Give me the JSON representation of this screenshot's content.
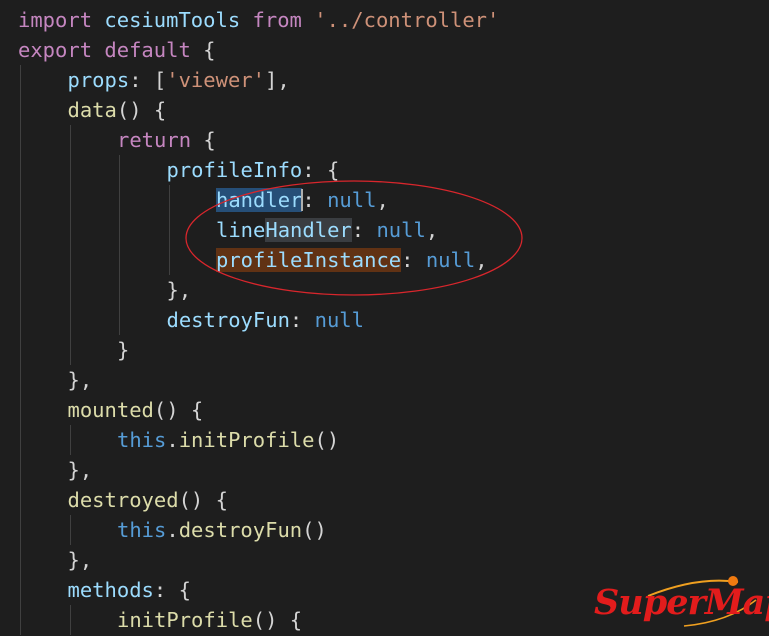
{
  "editor": {
    "theme": {
      "background": "#1e1e1e",
      "keyword": "#c586c0",
      "storage": "#569cd6",
      "variable": "#9cdcfe",
      "function": "#dcdcaa",
      "string": "#ce9178",
      "punctuation": "#d4d4d4",
      "selection": "#264f78",
      "word_highlight": "#3a3d41",
      "find_match": "#613214"
    },
    "lines": [
      {
        "indent": 0,
        "tokens": [
          {
            "t": "kw",
            "v": "import"
          },
          {
            "t": "p",
            "v": " "
          },
          {
            "t": "id",
            "v": "cesiumTools"
          },
          {
            "t": "p",
            "v": " "
          },
          {
            "t": "kw",
            "v": "from"
          },
          {
            "t": "p",
            "v": " "
          },
          {
            "t": "str",
            "v": "'../controller'"
          }
        ]
      },
      {
        "indent": 0,
        "tokens": [
          {
            "t": "kw",
            "v": "export"
          },
          {
            "t": "p",
            "v": " "
          },
          {
            "t": "kw",
            "v": "default"
          },
          {
            "t": "p",
            "v": " {"
          }
        ]
      },
      {
        "indent": 1,
        "tokens": [
          {
            "t": "id",
            "v": "props"
          },
          {
            "t": "p",
            "v": ": ["
          },
          {
            "t": "str",
            "v": "'viewer'"
          },
          {
            "t": "p",
            "v": "],"
          }
        ]
      },
      {
        "indent": 1,
        "tokens": [
          {
            "t": "fn",
            "v": "data"
          },
          {
            "t": "p",
            "v": "() {"
          }
        ]
      },
      {
        "indent": 2,
        "tokens": [
          {
            "t": "kw",
            "v": "return"
          },
          {
            "t": "p",
            "v": " {"
          }
        ]
      },
      {
        "indent": 3,
        "tokens": [
          {
            "t": "id",
            "v": "profileInfo"
          },
          {
            "t": "p",
            "v": ": {"
          }
        ]
      },
      {
        "indent": 4,
        "tokens": [
          {
            "t": "id",
            "v": "handler",
            "hl": "sel",
            "cursor": true
          },
          {
            "t": "p",
            "v": ": "
          },
          {
            "t": "kw2",
            "v": "null"
          },
          {
            "t": "p",
            "v": ","
          }
        ]
      },
      {
        "indent": 4,
        "tokens": [
          {
            "t": "id",
            "v": "line"
          },
          {
            "t": "id",
            "v": "Handler",
            "hl": "word"
          },
          {
            "t": "p",
            "v": ": "
          },
          {
            "t": "kw2",
            "v": "null"
          },
          {
            "t": "p",
            "v": ","
          }
        ]
      },
      {
        "indent": 4,
        "tokens": [
          {
            "t": "id",
            "v": "profileInstance",
            "hl": "find"
          },
          {
            "t": "p",
            "v": ": "
          },
          {
            "t": "kw2",
            "v": "null"
          },
          {
            "t": "p",
            "v": ","
          }
        ]
      },
      {
        "indent": 3,
        "tokens": [
          {
            "t": "p",
            "v": "},"
          }
        ]
      },
      {
        "indent": 3,
        "tokens": [
          {
            "t": "id",
            "v": "destroyFun"
          },
          {
            "t": "p",
            "v": ": "
          },
          {
            "t": "kw2",
            "v": "null"
          }
        ]
      },
      {
        "indent": 2,
        "tokens": [
          {
            "t": "p",
            "v": "}"
          }
        ]
      },
      {
        "indent": 1,
        "tokens": [
          {
            "t": "p",
            "v": "},"
          }
        ]
      },
      {
        "indent": 1,
        "tokens": [
          {
            "t": "fn",
            "v": "mounted"
          },
          {
            "t": "p",
            "v": "() {"
          }
        ]
      },
      {
        "indent": 2,
        "tokens": [
          {
            "t": "kw2",
            "v": "this"
          },
          {
            "t": "p",
            "v": "."
          },
          {
            "t": "fn",
            "v": "initProfile"
          },
          {
            "t": "p",
            "v": "()"
          }
        ]
      },
      {
        "indent": 1,
        "tokens": [
          {
            "t": "p",
            "v": "},"
          }
        ]
      },
      {
        "indent": 1,
        "tokens": [
          {
            "t": "fn",
            "v": "destroyed"
          },
          {
            "t": "p",
            "v": "() {"
          }
        ]
      },
      {
        "indent": 2,
        "tokens": [
          {
            "t": "kw2",
            "v": "this"
          },
          {
            "t": "p",
            "v": "."
          },
          {
            "t": "fn",
            "v": "destroyFun"
          },
          {
            "t": "p",
            "v": "()"
          }
        ]
      },
      {
        "indent": 1,
        "tokens": [
          {
            "t": "p",
            "v": "},"
          }
        ]
      },
      {
        "indent": 1,
        "tokens": [
          {
            "t": "id",
            "v": "methods"
          },
          {
            "t": "p",
            "v": ": {"
          }
        ]
      },
      {
        "indent": 2,
        "tokens": [
          {
            "t": "fn",
            "v": "initProfile"
          },
          {
            "t": "p",
            "v": "() {"
          }
        ]
      }
    ]
  },
  "annotation": {
    "shape": "ellipse",
    "color": "#d9262c"
  },
  "watermark": {
    "text": "SuperMap",
    "text_color": "#e21c1c",
    "orbit_color": "#f0a020"
  }
}
